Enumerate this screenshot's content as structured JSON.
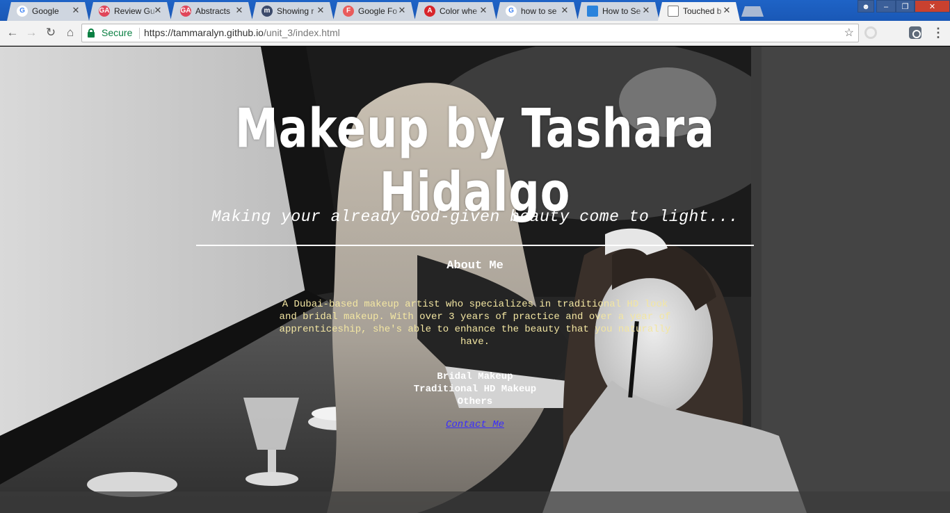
{
  "browser": {
    "tabs": [
      {
        "title": "Google",
        "favicon": "google-icon",
        "color": "#ffffff",
        "glyph": "G",
        "glyph_color": "#4285f4"
      },
      {
        "title": "Review Gu",
        "favicon": "ga-icon",
        "color": "#e0465a",
        "glyph": "GA",
        "glyph_color": "#ffffff"
      },
      {
        "title": "Abstracts",
        "favicon": "ga-icon",
        "color": "#e0465a",
        "glyph": "GA",
        "glyph_color": "#ffffff"
      },
      {
        "title": "Showing r",
        "favicon": "github-icon",
        "color": "#3b4a6b",
        "glyph": "m",
        "glyph_color": "#ffffff"
      },
      {
        "title": "Google Fo",
        "favicon": "google-fonts-icon",
        "color": "#e95b5b",
        "glyph": "F",
        "glyph_color": "#ffffff"
      },
      {
        "title": "Color whe",
        "favicon": "adobe-icon",
        "color": "#d8252a",
        "glyph": "A",
        "glyph_color": "#ffffff"
      },
      {
        "title": "how to se",
        "favicon": "google-icon",
        "color": "#ffffff",
        "glyph": "G",
        "glyph_color": "#4285f4"
      },
      {
        "title": "How to Se",
        "favicon": "docs-icon",
        "color": "#2a83dc",
        "glyph": "",
        "glyph_color": "#ffffff"
      },
      {
        "title": "Touched b",
        "favicon": "page-icon",
        "color": "#ffffff",
        "glyph": "",
        "glyph_color": "#555555",
        "active": true
      }
    ],
    "address": {
      "secure_label": "Secure",
      "url_host": "https://tammaralyn.github.io",
      "url_path": "/unit_3/index.html"
    }
  },
  "page": {
    "title": "Makeup by Tashara Hidalgo",
    "tagline": "Making your already God-given beauty come to light...",
    "about_heading": "About Me",
    "about_text": "A Dubai-based makeup artist who specializes in traditional HD look and bridal makeup. With over 3 years of practice and over a year of apprenticeship, she's able to enhance the beauty that you naturally have.",
    "services": [
      "Bridal Makeup",
      "Traditional HD Makeup",
      "Others"
    ],
    "contact_label": "Contact Me"
  }
}
